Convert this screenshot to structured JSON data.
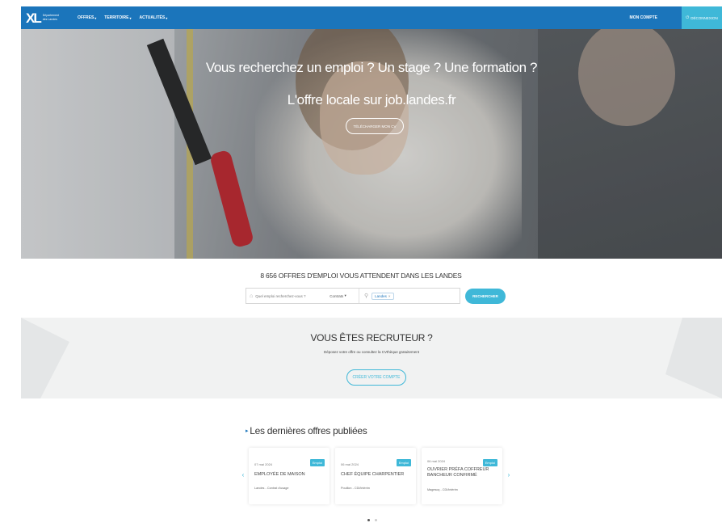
{
  "header": {
    "logo_mark": "XL",
    "logo_text": "Département des Landes",
    "nav": [
      {
        "label": "OFFRES"
      },
      {
        "label": "TERRITOIRE"
      },
      {
        "label": "ACTUALITÉS"
      }
    ],
    "account_label": "MON COMPTE",
    "logout_label": "DÉCONNEXION",
    "brand_color": "#1b75bb",
    "accent_color": "#3fb8d8"
  },
  "hero": {
    "title": "Vous recherchez un emploi ? Un stage ? Une formation ?",
    "subtitle": "L'offre locale sur job.landes.fr",
    "cv_button": "TÉLÉCHARGER MON CV"
  },
  "search": {
    "offers_count_text": "8 656 OFFRES D'EMPLOI VOUS ATTENDENT DANS LES LANDES",
    "query_placeholder": "Quel emploi recherchez-vous ?",
    "contract_label": "Contrats",
    "location_tag": "Landes",
    "search_button": "RECHERCHER"
  },
  "recruiter": {
    "title": "VOUS ÊTES RECRUTEUR ?",
    "subtitle": "Déposez votre offre ou consultez la CVthèque gratuitement",
    "create_button": "CRÉER VOTRE COMPTE"
  },
  "latest": {
    "title": "Les dernières offres publiées",
    "cards": [
      {
        "date": "07 mai 2024",
        "badge": "Emploi",
        "title": "EMPLOYÉE DE MAISON",
        "meta": "Landes - Contrat d'usage"
      },
      {
        "date": "06 mai 2024",
        "badge": "Emploi",
        "title": "CHEF ÉQUIPE CHARPENTIER",
        "meta": "Pouillon - CDI/intérim"
      },
      {
        "date": "06 mai 2024",
        "badge": "Emploi",
        "title": "OUVRIER PRÉFA COFFREUR BANCHEUR CONFIRMÉ",
        "meta": "Magescq - CDI/intérim"
      }
    ]
  },
  "icons": {
    "search": "search-icon",
    "location": "location-pin-icon",
    "logout": "power-icon",
    "prev": "chevron-left-icon",
    "next": "chevron-right-icon"
  }
}
